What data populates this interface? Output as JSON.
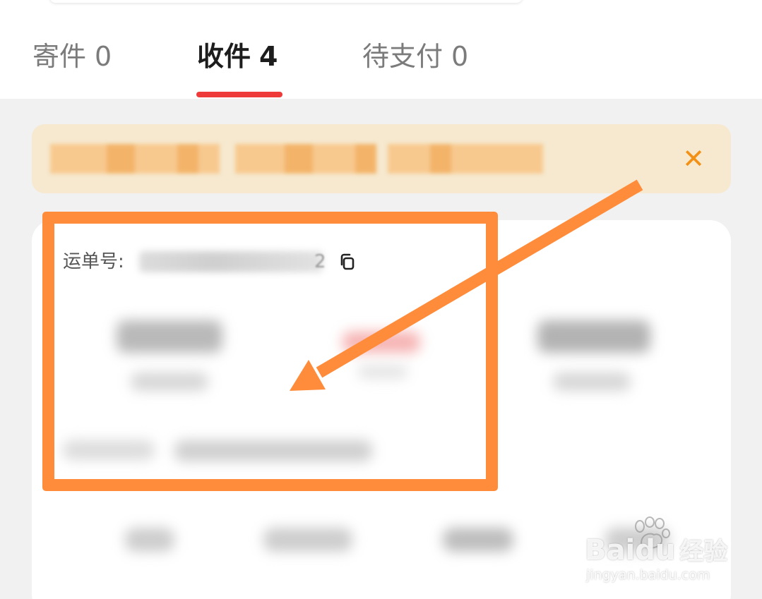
{
  "tabs": [
    {
      "label": "寄件",
      "count": "0",
      "active": false
    },
    {
      "label": "收件",
      "count": "4",
      "active": true
    },
    {
      "label": "待支付",
      "count": "0",
      "active": false
    }
  ],
  "notice": {
    "close_icon": "✕"
  },
  "card": {
    "waybill_label": "运单号:",
    "waybill_tail": "2",
    "copy_icon": "copy-icon"
  },
  "watermark": {
    "brand_a": "Bai",
    "brand_b": "du",
    "brand_cn": "经验",
    "sub": "jingyan.baidu.com"
  },
  "colors": {
    "accent_tab": "#ef3a3a",
    "annotation": "#ff8c3a",
    "notice_bg": "#f6e9cf",
    "close_icon": "#f39016"
  }
}
